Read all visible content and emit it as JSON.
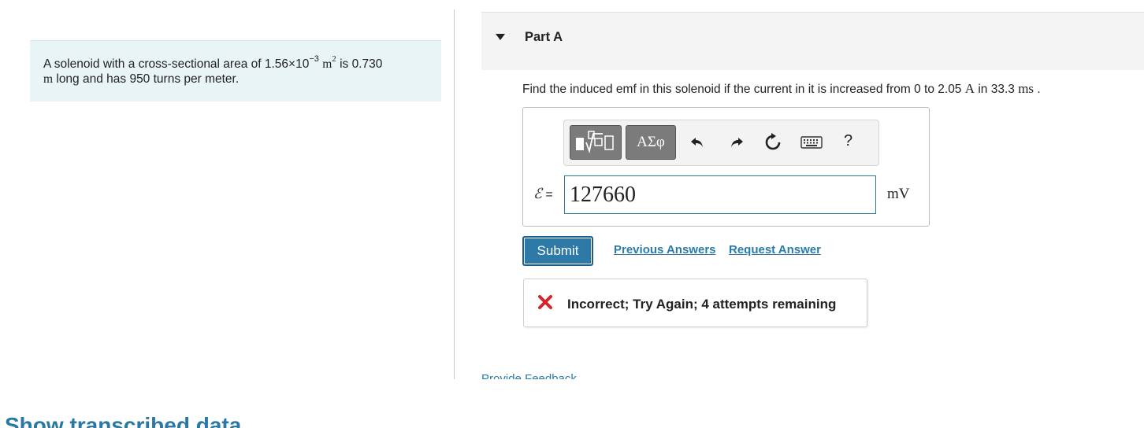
{
  "problem": {
    "text_pre": "A solenoid with a cross-sectional area of 1.56×10",
    "exp": "−3",
    "unit_m": "m",
    "unit_exp": "2",
    "text_mid": " is 0.730",
    "line2_unit": "m",
    "line2_text": " long and has 950 turns per meter."
  },
  "part": {
    "title": "Part A"
  },
  "question": {
    "pre": "Find the induced emf in this solenoid if the current in it is increased from 0 to 2.05 ",
    "unit_a": "A",
    "mid": " in 33.3 ",
    "unit_ms": "ms",
    "post": " ."
  },
  "toolbar": {
    "templates_icon": "fraction-sqrt-icon",
    "greek_label": "ΑΣφ",
    "undo_icon": "undo-icon",
    "redo_icon": "redo-icon",
    "reset_icon": "reset-icon",
    "keyboard_icon": "keyboard-icon",
    "help_label": "?"
  },
  "answer": {
    "symbol": "ℰ",
    "equals": " =",
    "value": "127660",
    "unit": "mV"
  },
  "actions": {
    "submit": "Submit",
    "previous": "Previous Answers",
    "request": "Request Answer"
  },
  "feedback": {
    "icon": "x-icon",
    "text": "Incorrect; Try Again; 4 attempts remaining",
    "color": "#d3252c"
  },
  "footer": {
    "provide_feedback": "Provide Feedback",
    "show_transcribed": "Show transcribed data"
  },
  "colors": {
    "accent": "#2d7aa8",
    "link": "#2b7aa8",
    "problem_bg": "#e8f4f6",
    "toolbar_button": "#7b7b7b"
  }
}
